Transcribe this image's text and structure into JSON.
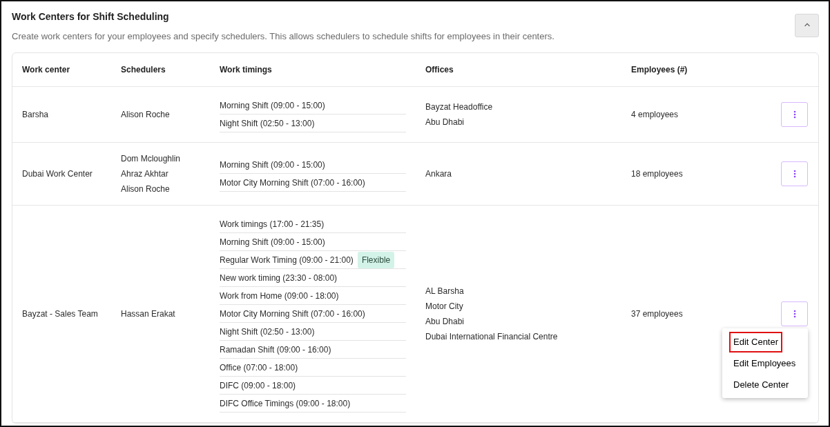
{
  "section": {
    "title": "Work Centers for Shift Scheduling",
    "description": "Create work centers for your employees and specify schedulers. This allows schedulers to schedule shifts for employees in their centers.",
    "expanded": true
  },
  "table": {
    "columns": [
      "Work center",
      "Schedulers",
      "Work timings",
      "Offices",
      "Employees (#)"
    ],
    "rows": [
      {
        "work_center": "Barsha",
        "schedulers": [
          "Alison Roche"
        ],
        "work_timings": [
          {
            "label": "Morning Shift (09:00 - 15:00)"
          },
          {
            "label": "Night Shift (02:50 - 13:00)"
          }
        ],
        "offices": [
          "Bayzat Headoffice",
          "Abu Dhabi"
        ],
        "employees": "4 employees",
        "menu_open": false
      },
      {
        "work_center": "Dubai Work Center",
        "schedulers": [
          "Dom Mcloughlin",
          "Ahraz Akhtar",
          "Alison Roche"
        ],
        "work_timings": [
          {
            "label": "Morning Shift (09:00 - 15:00)"
          },
          {
            "label": "Motor City Morning Shift (07:00 - 16:00)"
          }
        ],
        "offices": [
          "Ankara"
        ],
        "employees": "18 employees",
        "menu_open": false
      },
      {
        "work_center": "Bayzat - Sales Team",
        "schedulers": [
          "Hassan Erakat"
        ],
        "work_timings": [
          {
            "label": "Work timings (17:00 - 21:35)"
          },
          {
            "label": "Morning Shift (09:00 - 15:00)"
          },
          {
            "label": "Regular Work Timing (09:00 - 21:00)",
            "tag": "Flexible"
          },
          {
            "label": "New work timing (23:30 - 08:00)"
          },
          {
            "label": "Work from Home (09:00 - 18:00)"
          },
          {
            "label": "Motor City Morning Shift (07:00 - 16:00)"
          },
          {
            "label": "Night Shift (02:50 - 13:00)"
          },
          {
            "label": "Ramadan Shift (09:00 - 16:00)"
          },
          {
            "label": "Office (07:00 - 18:00)"
          },
          {
            "label": "DIFC (09:00 - 18:00)"
          },
          {
            "label": "DIFC Office Timings (09:00 - 18:00)"
          }
        ],
        "offices": [
          "AL Barsha",
          "Motor City",
          "Abu Dhabi",
          "Dubai International Financial Centre"
        ],
        "employees": "37 employees",
        "menu_open": true
      }
    ]
  },
  "row_menu": {
    "items": [
      {
        "label": "Edit Center",
        "highlighted": true
      },
      {
        "label": "Edit Employees",
        "highlighted": false
      },
      {
        "label": "Delete Center",
        "highlighted": false
      }
    ]
  }
}
